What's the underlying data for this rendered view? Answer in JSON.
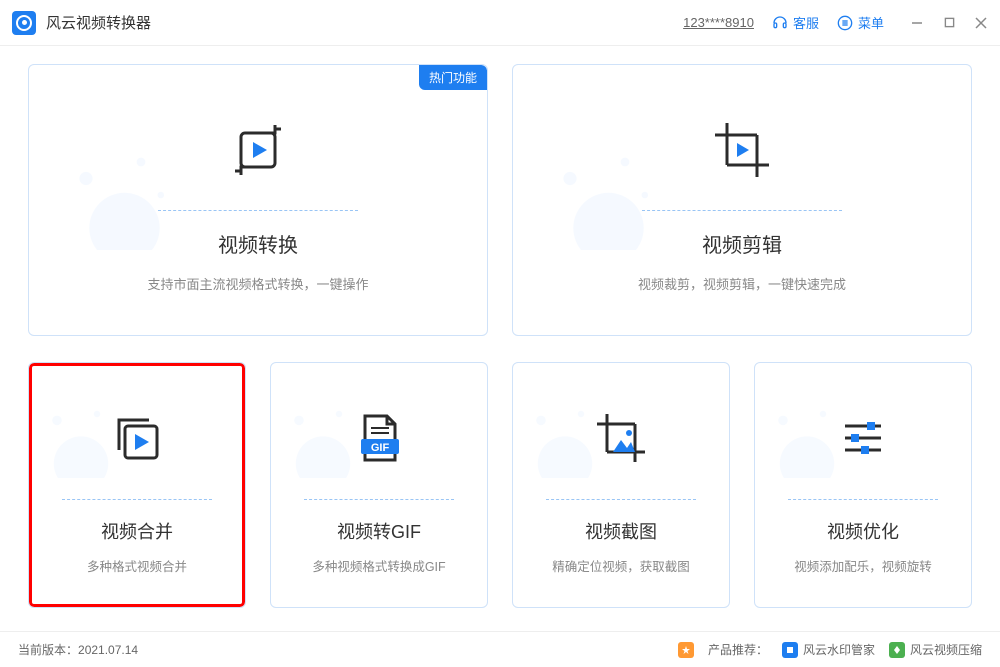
{
  "titlebar": {
    "app_title": "风云视频转换器",
    "user_id": "123****8910",
    "support_label": "客服",
    "menu_label": "菜单"
  },
  "cards": {
    "hot_badge": "热门功能",
    "convert": {
      "title": "视频转换",
      "desc": "支持市面主流视频格式转换，一键操作"
    },
    "edit": {
      "title": "视频剪辑",
      "desc": "视频裁剪，视频剪辑，一键快速完成"
    },
    "merge": {
      "title": "视频合并",
      "desc": "多种格式视频合并"
    },
    "gif": {
      "title": "视频转GIF",
      "desc": "多种视频格式转换成GIF"
    },
    "screenshot": {
      "title": "视频截图",
      "desc": "精确定位视频，获取截图"
    },
    "optimize": {
      "title": "视频优化",
      "desc": "视频添加配乐，视频旋转"
    }
  },
  "footer": {
    "version_label": "当前版本：",
    "version": "2021.07.14",
    "recommend_label": "产品推荐：",
    "product1": "风云水印管家",
    "product2": "风云视频压缩"
  },
  "colors": {
    "primary": "#1e7ef0",
    "border": "#cfe2f9",
    "highlight": "#ff0000"
  }
}
